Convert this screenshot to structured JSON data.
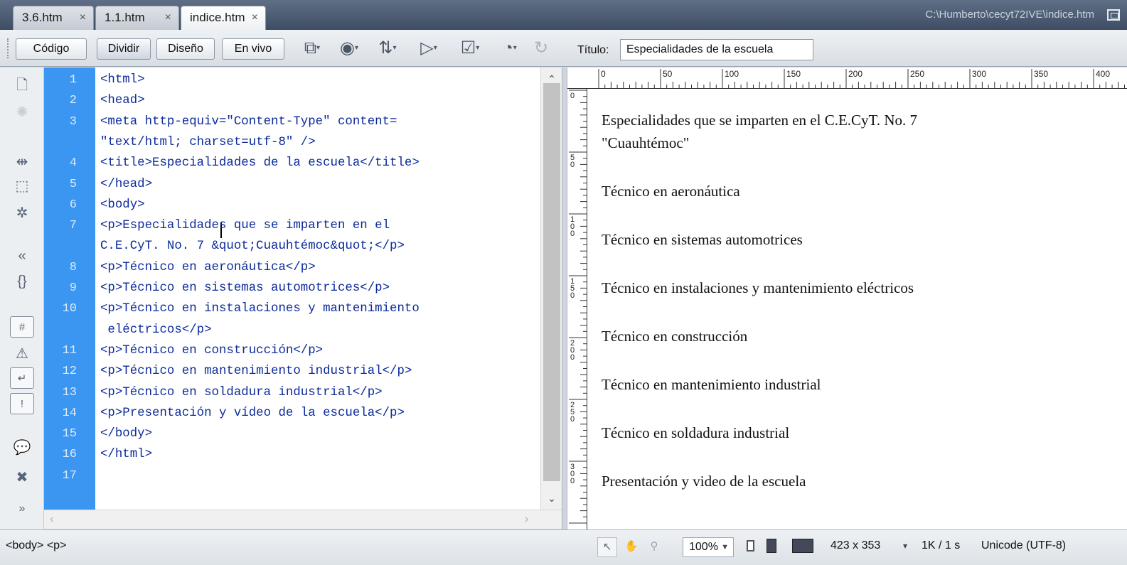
{
  "tabs": [
    {
      "label": "3.6.htm",
      "close": "×"
    },
    {
      "label": "1.1.htm",
      "close": "×"
    },
    {
      "label": "indice.htm",
      "close": "×"
    }
  ],
  "file_path": "C:\\Humberto\\cecyt72IVE\\indice.htm",
  "view_buttons": [
    "Código",
    "Dividir",
    "Diseño",
    "En vivo"
  ],
  "toolbar": {
    "icons": [
      "file-management-icon",
      "preview-browser-icon",
      "refresh-design-icon",
      "visual-aids-icon",
      "validate-markup-icon",
      "check-browser-compat-icon",
      "refresh-icon"
    ],
    "title_label": "Título:",
    "title_value": "Especialidades de la escuela"
  },
  "line_numbers": [
    "1",
    "2",
    "3",
    "",
    "4",
    "5",
    "6",
    "7",
    "",
    "8",
    "9",
    "10",
    "",
    "11",
    "12",
    "13",
    "14",
    "15",
    "16",
    "17"
  ],
  "code_lines": [
    "<html>",
    "<head>",
    "<meta http-equiv=\"Content-Type\" content=",
    "\"text/html; charset=utf-8\" />",
    "<title>Especialidades de la escuela</title>",
    "</head>",
    "<body>",
    "<p>Especialidades que se imparten en el",
    "C.E.CyT. No. 7 &quot;Cuauhtémoc&quot;</p>",
    "<p>Técnico en aeronáutica</p>",
    "<p>Técnico en sistemas automotrices</p>",
    "<p>Técnico en instalaciones y mantenimiento",
    " eléctricos</p>",
    "<p>Técnico en construcción</p>",
    "<p>Técnico en mantenimiento industrial</p>",
    "<p>Técnico en soldadura industrial</p>",
    "<p>Presentación y vídeo de la escuela</p>",
    "</body>",
    "</html>",
    ""
  ],
  "ruler_top": [
    "0",
    "50",
    "100",
    "150",
    "200",
    "250",
    "300",
    "350",
    "400"
  ],
  "ruler_left": [
    "0",
    "50",
    "100",
    "150",
    "200",
    "250",
    "300"
  ],
  "design_paragraphs": [
    "Especialidades que se imparten en el C.E.CyT. No. 7",
    "\"Cuauhtémoc\"",
    "Técnico en aeronáutica",
    "Técnico en sistemas automotrices",
    "Técnico en instalaciones y mantenimiento eléctricos",
    "Técnico en construcción",
    "Técnico en mantenimiento industrial",
    "Técnico en soldadura industrial",
    "Presentación y video de la escuela"
  ],
  "status": {
    "tag_selector": "<body> <p>",
    "zoom": "100%",
    "window_size": "423 x 353",
    "size_time": "1K / 1 s",
    "encoding": "Unicode (UTF-8)"
  }
}
